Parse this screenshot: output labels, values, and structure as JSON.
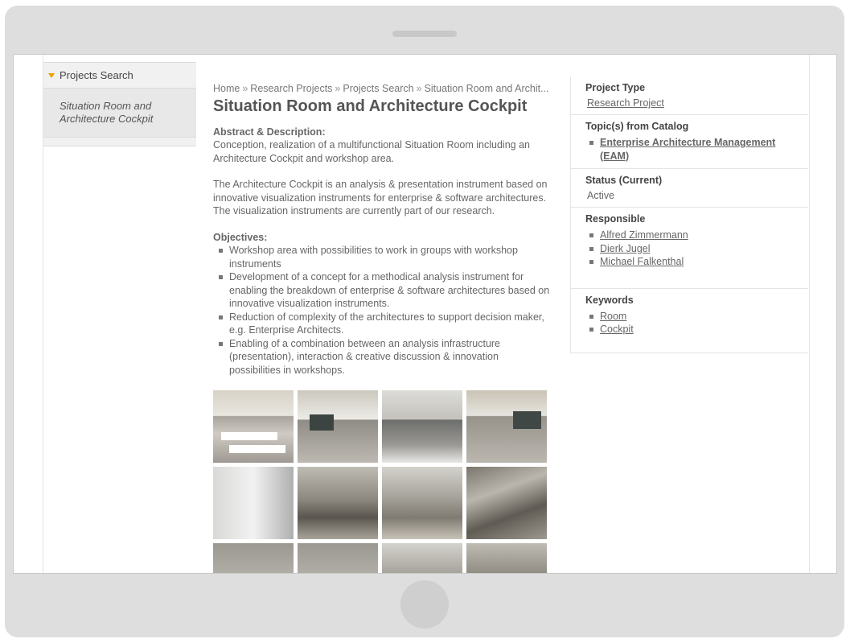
{
  "left_nav": {
    "header": "Projects Search",
    "current_item": "Situation Room and Architecture Cockpit"
  },
  "breadcrumb": [
    "Home",
    "Research Projects",
    "Projects Search",
    "Situation Room and Archit..."
  ],
  "breadcrumb_separator": "»",
  "title": "Situation Room and Architecture Cockpit",
  "abstract": {
    "label": "Abstract & Description:",
    "para1": "Conception, realization of a multifunctional Situation Room including an Architecture Cockpit and workshop area.",
    "para2": "The Architecture Cockpit is an analysis & presentation instrument based on innovative visualization instruments for enterprise & software architectures. The visualization instruments are currently part of our research."
  },
  "objectives": {
    "label": "Objectives:",
    "items": [
      "Workshop area with possibilities to work in groups with workshop instruments",
      "Development of a concept for a methodical analysis instrument for enabling the breakdown of enterprise & software architectures based on innovative visualization instruments.",
      "Reduction of complexity of the architectures to support decision maker, e.g. Enterprise Architects.",
      "Enabling of a combination between an analysis infrastructure (presentation), interaction & creative discussion & innovation possibilities in workshops."
    ]
  },
  "sidebar": {
    "project_type": {
      "heading": "Project Type",
      "value": "Research Project"
    },
    "topics": {
      "heading": "Topic(s) from Catalog",
      "items": [
        "Enterprise Architecture Management (EAM)"
      ]
    },
    "status": {
      "heading": "Status (Current)",
      "value": "Active"
    },
    "responsible": {
      "heading": "Responsible",
      "items": [
        "Alfred Zimmermann",
        "Dierk Jugel",
        "Michael Falkenthal"
      ]
    },
    "keywords": {
      "heading": "Keywords",
      "items": [
        "Room",
        "Cockpit"
      ]
    }
  },
  "colors": {
    "accent_triangle": "#f0a000",
    "device_frame": "#dedede"
  }
}
